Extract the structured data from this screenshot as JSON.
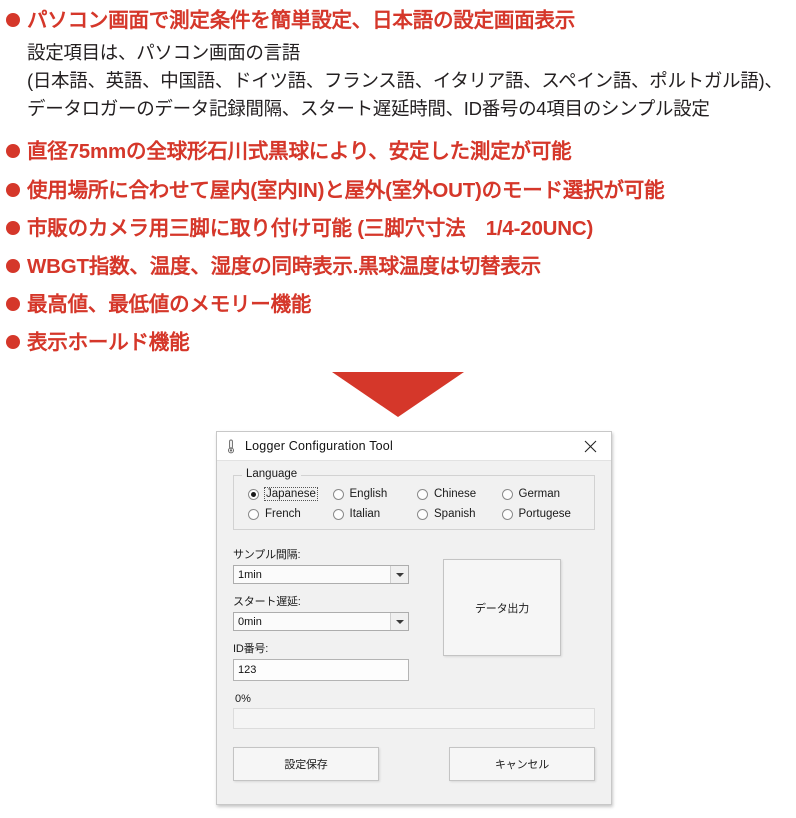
{
  "theme": {
    "brand_red": "#d5372a",
    "body_text": "#231f20",
    "dialog_bg": "#f1f1f1"
  },
  "features": {
    "items": [
      {
        "bullet": "●",
        "text": "パソコン画面で測定条件を簡単設定、日本語の設定画面表示",
        "sub": "設定項目は、パソコン画面の言語\n(日本語、英語、中国語、ドイツ語、フランス語、イタリア語、スペイン語、ポルトガル語)、\nデータロガーのデータ記録間隔、スタート遅延時間、ID番号の4項目のシンプル設定"
      },
      {
        "bullet": "●",
        "text": "直径75mmの全球形石川式黒球により、安定した測定が可能"
      },
      {
        "bullet": "●",
        "text": "使用場所に合わせて屋内(室内IN)と屋外(室外OUT)のモード選択が可能"
      },
      {
        "bullet": "●",
        "text": "市販のカメラ用三脚に取り付け可能 (三脚穴寸法　1/4-20UNC)"
      },
      {
        "bullet": "●",
        "text": "WBGT指数、温度、湿度の同時表示.黒球温度は切替表示"
      },
      {
        "bullet": "●",
        "text": "最高値、最低値のメモリー機能"
      },
      {
        "bullet": "●",
        "text": "表示ホールド機能"
      }
    ]
  },
  "arrow": {
    "icon": "down-arrow-icon",
    "color": "#d5372a"
  },
  "dialog": {
    "title": "Logger Configuration Tool",
    "title_icon": "thermometer-icon",
    "close_icon": "close-icon",
    "language": {
      "legend": "Language",
      "options": [
        {
          "label": "Japanese",
          "selected": true
        },
        {
          "label": "English",
          "selected": false
        },
        {
          "label": "Chinese",
          "selected": false
        },
        {
          "label": "German",
          "selected": false
        },
        {
          "label": "French",
          "selected": false
        },
        {
          "label": "Italian",
          "selected": false
        },
        {
          "label": "Spanish",
          "selected": false
        },
        {
          "label": "Portugese",
          "selected": false
        }
      ]
    },
    "sample_interval": {
      "label": "サンプル間隔:",
      "value": "1min"
    },
    "start_delay": {
      "label": "スタート遅延:",
      "value": "0min"
    },
    "id_number": {
      "label": "ID番号:",
      "value": "123"
    },
    "data_output_button": "データ出力",
    "progress": {
      "label": "0%",
      "percent": 0
    },
    "save_button": "設定保存",
    "cancel_button": "キャンセル"
  }
}
